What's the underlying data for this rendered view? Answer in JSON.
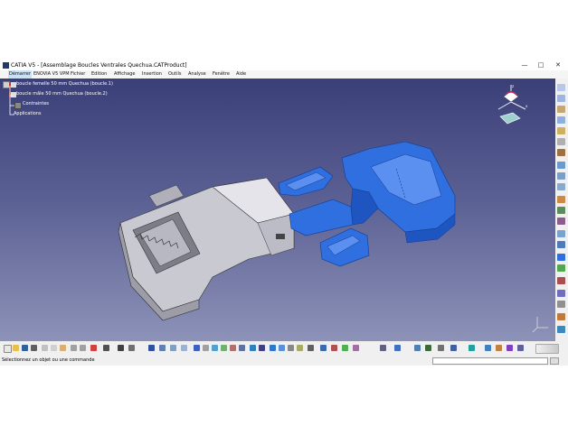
{
  "window": {
    "title": "CATIA V5 - [Assemblage Boucles Ventrales Quechua.CATProduct]",
    "minimize": "—",
    "maximize": "□",
    "close": "✕"
  },
  "menu": {
    "items": [
      "Démarrer",
      "ENOVIA V5 VPM",
      "Fichier",
      "Edition",
      "Affichage",
      "Insertion",
      "Outils",
      "Analyse",
      "Fenêtre",
      "Aide"
    ]
  },
  "tree": {
    "root": "",
    "items": [
      "boucle femelle 50 mm Quechua (boucle.1)",
      "boucle mâle 50 mm Quechua (boucle.2)",
      "Contraintes",
      "Applications"
    ]
  },
  "status": {
    "message": "Sélectionnez un objet ou une commande",
    "command_value": ""
  },
  "colors": {
    "part_female": "#d8d8e0",
    "part_male": "#2f6fe0",
    "viewport_top": "#3b3f78",
    "viewport_bottom": "#8d92b8"
  },
  "icons": {
    "compass": "compass-icon",
    "axis": "xyz-axis-icon"
  }
}
